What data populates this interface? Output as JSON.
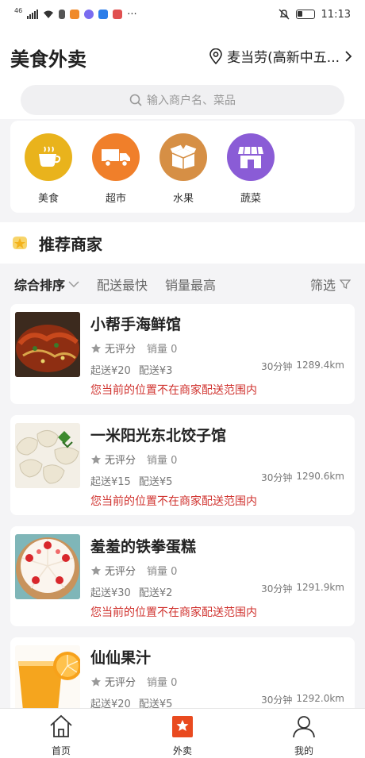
{
  "statusbar": {
    "net": "46",
    "time": "11:13",
    "more": "···"
  },
  "header": {
    "title": "美食外卖",
    "location": "麦当劳(高新中五...",
    "search_placeholder": "输入商户名、菜品"
  },
  "categories": [
    {
      "label": "美食",
      "color": "#e9b31c",
      "icon": "coffee-cup-icon"
    },
    {
      "label": "超市",
      "color": "#f07f2a",
      "icon": "truck-icon"
    },
    {
      "label": "水果",
      "color": "#d68f45",
      "icon": "box-icon"
    },
    {
      "label": "蔬菜",
      "color": "#8a5cd6",
      "icon": "store-icon"
    }
  ],
  "section": {
    "title": "推荐商家"
  },
  "filters": {
    "sort": "综合排序",
    "fastest": "配送最快",
    "top_sales": "销量最高",
    "screen": "筛选"
  },
  "shops": [
    {
      "name": "小帮手海鲜馆",
      "rating": "无评分",
      "sales": "销量 0",
      "min_order": "起送¥20",
      "delivery_fee": "配送¥3",
      "time": "30分钟",
      "distance": "1289.4km",
      "warning": "您当前的位置不在商家配送范围内"
    },
    {
      "name": "一米阳光东北饺子馆",
      "rating": "无评分",
      "sales": "销量 0",
      "min_order": "起送¥15",
      "delivery_fee": "配送¥5",
      "time": "30分钟",
      "distance": "1290.6km",
      "warning": "您当前的位置不在商家配送范围内"
    },
    {
      "name": "羞羞的铁拳蛋糕",
      "rating": "无评分",
      "sales": "销量 0",
      "min_order": "起送¥30",
      "delivery_fee": "配送¥2",
      "time": "30分钟",
      "distance": "1291.9km",
      "warning": "您当前的位置不在商家配送范围内"
    },
    {
      "name": "仙仙果汁",
      "rating": "无评分",
      "sales": "销量 0",
      "min_order": "起送¥20",
      "delivery_fee": "配送¥5",
      "time": "30分钟",
      "distance": "1292.0km",
      "warning": ""
    }
  ],
  "nav": [
    {
      "label": "首页",
      "icon": "home-icon",
      "active": false
    },
    {
      "label": "外卖",
      "icon": "takeout-icon",
      "active": true
    },
    {
      "label": "我的",
      "icon": "user-icon",
      "active": false
    }
  ],
  "colors": {
    "accent": "#e94a1f",
    "warning": "#d0322e",
    "star": "#f3c13a"
  }
}
